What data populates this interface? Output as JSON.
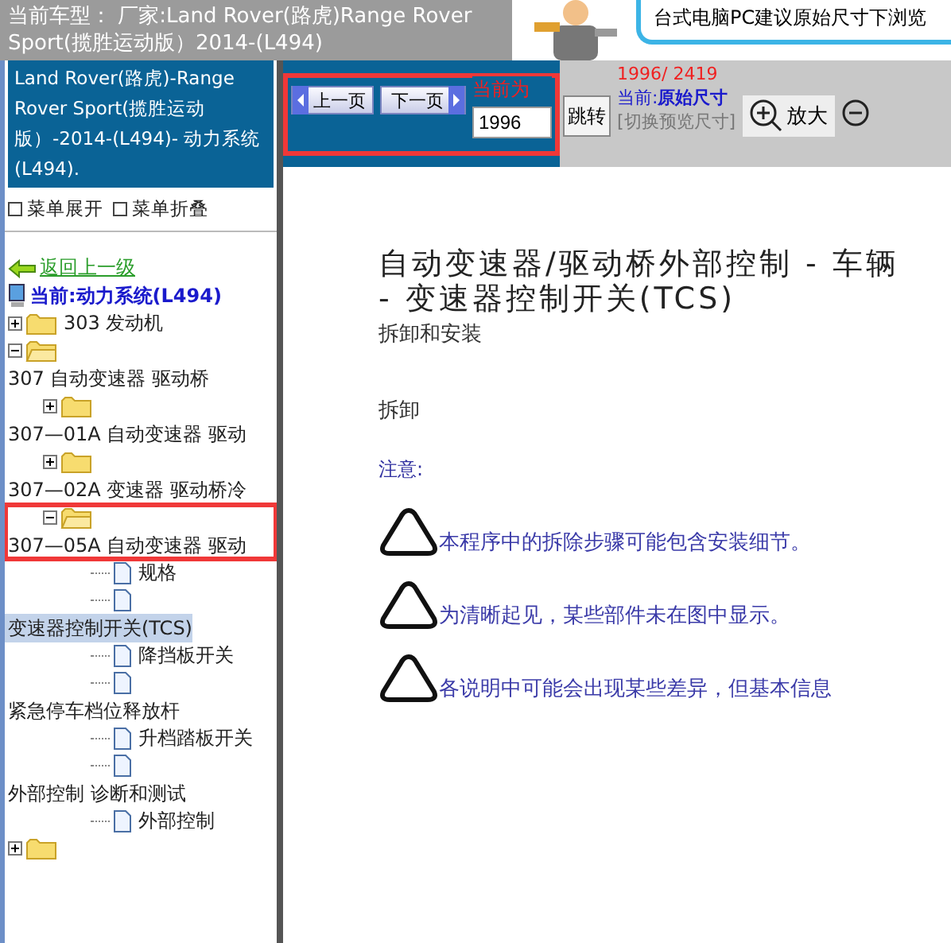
{
  "header": {
    "vehicle_lines": [
      "当前车型： 厂家:Land Rover(路虎)Range Rover",
      "Sport(揽胜运动版）2014-(L494)"
    ],
    "banner": "台式电脑PC建议原始尺寸下浏览"
  },
  "sidebar": {
    "title": "Land Rover(路虎)-Range Rover Sport(揽胜运动版）-2014-(L494)- 动力系统(L494).",
    "menu_actions": [
      {
        "label": "菜单展开"
      },
      {
        "label": "菜单折叠"
      }
    ],
    "back_link": "返回上一级",
    "current": "当前:动力系统(L494)",
    "tree": [
      {
        "kind": "folder",
        "label": "303 发动机",
        "wrapped": false,
        "expanded": false,
        "highlighted": false
      },
      {
        "kind": "folder",
        "label": "307 自动变速器 驱动桥",
        "wrapped": true,
        "expanded": true,
        "highlighted": false,
        "children": [
          {
            "kind": "folder",
            "label": "307—01A 自动变速器 驱动",
            "wrapped": true,
            "expanded": false,
            "highlighted": false
          },
          {
            "kind": "folder",
            "label": "307—02A 变速器 驱动桥冷",
            "wrapped": true,
            "expanded": false,
            "highlighted": false
          },
          {
            "kind": "folder",
            "label": "307—05A 自动变速器 驱动",
            "wrapped": true,
            "expanded": true,
            "highlighted": true,
            "children": [
              {
                "kind": "page",
                "label": "规格",
                "wrapped": false,
                "selected": false
              },
              {
                "kind": "page",
                "label": "变速器控制开关(TCS)",
                "wrapped": true,
                "selected": true
              },
              {
                "kind": "page",
                "label": "降挡板开关",
                "wrapped": false,
                "selected": false
              },
              {
                "kind": "page",
                "label": "紧急停车档位释放杆",
                "wrapped": true,
                "selected": false
              },
              {
                "kind": "page",
                "label": "升档踏板开关",
                "wrapped": false,
                "selected": false
              },
              {
                "kind": "page",
                "label": "外部控制 诊断和测试",
                "wrapped": true,
                "selected": false
              },
              {
                "kind": "page",
                "label": "外部控制",
                "wrapped": false,
                "selected": false
              }
            ]
          }
        ]
      },
      {
        "kind": "folder",
        "expanded": false,
        "highlighted": false
      }
    ]
  },
  "toolbar": {
    "prev": "上一页",
    "next": "下一页",
    "highlighted": true,
    "current_label": "当前为",
    "page_input": "1996",
    "jump": "跳转",
    "page_count": "1996/ 2419",
    "size_prefix": "当前:",
    "size_value": "原始尺寸",
    "size_switch": "[切换预览尺寸]",
    "zoom_in": "放大"
  },
  "document": {
    "title_lines": [
      "自动变速器/驱动桥外部控制 - 车辆",
      "- 变速器控制开关(TCS)"
    ],
    "subtitle": "拆卸和安装",
    "section": "拆卸",
    "note_heading": "注意:",
    "notes": [
      "本程序中的拆除步骤可能包含安装细节。",
      "为清晰起见，某些部件未在图中显示。",
      "各说明中可能会出现某些差异，但基本信息"
    ]
  }
}
